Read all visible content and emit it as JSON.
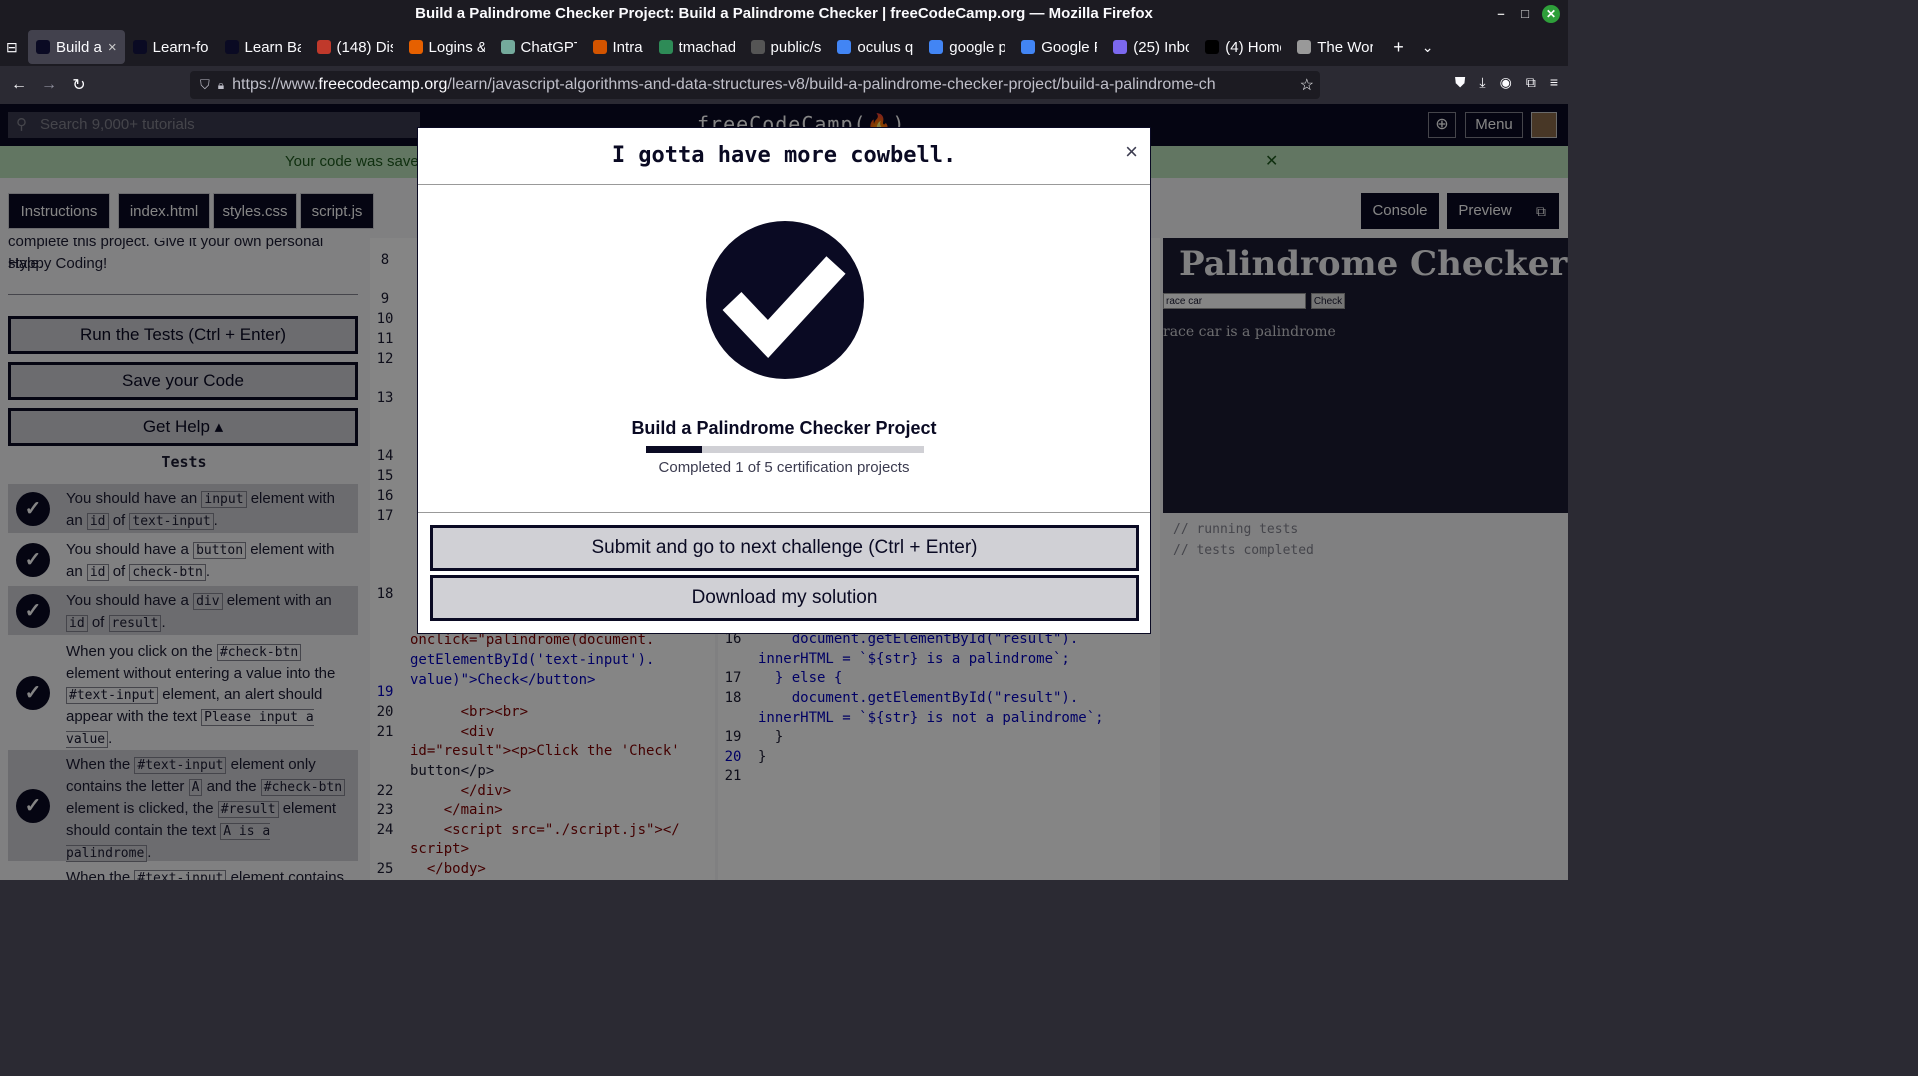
{
  "window": {
    "title": "Build a Palindrome Checker Project: Build a Palindrome Checker | freeCodeCamp.org — Mozilla Firefox"
  },
  "tabs": [
    {
      "label": "Build a",
      "icon": "fcc-icon",
      "color": "#0a0a23",
      "active": true
    },
    {
      "label": "Learn-fo",
      "icon": "fcc-icon",
      "color": "#0a0a23"
    },
    {
      "label": "Learn Ba",
      "icon": "fcc-icon",
      "color": "#0a0a23"
    },
    {
      "label": "(148) Dis",
      "icon": "badge-icon",
      "color": "#c0392b"
    },
    {
      "label": "Logins &",
      "icon": "firefox-icon",
      "color": "#e66000"
    },
    {
      "label": "ChatGPT",
      "icon": "chatgpt-icon",
      "color": "#74aa9c"
    },
    {
      "label": "Intra",
      "icon": "code-icon",
      "color": "#d35400"
    },
    {
      "label": "tmachad",
      "icon": "bug-icon",
      "color": "#2e8b57"
    },
    {
      "label": "public/s",
      "icon": "github-icon",
      "color": "#555555"
    },
    {
      "label": "oculus q",
      "icon": "google-icon",
      "color": "#4285f4"
    },
    {
      "label": "google p",
      "icon": "google-icon",
      "color": "#4285f4"
    },
    {
      "label": "Google F",
      "icon": "google-icon",
      "color": "#4285f4"
    },
    {
      "label": "(25) Inbo",
      "icon": "mail-icon",
      "color": "#7b68ee"
    },
    {
      "label": "(4) Home",
      "icon": "x-icon",
      "color": "#000000"
    },
    {
      "label": "The Wor",
      "icon": "globe-icon",
      "color": "#999999"
    }
  ],
  "url": {
    "prefix": "https://www.",
    "host": "freecodecamp.org",
    "path": "/learn/javascript-algorithms-and-data-structures-v8/build-a-palindrome-checker-project/build-a-palindrome-ch"
  },
  "fcc": {
    "search_placeholder": "Search 9,000+ tutorials",
    "logo": "freeCodeCamp(🔥)",
    "menu": "Menu"
  },
  "banner": {
    "text": "Your code was saved"
  },
  "workspace_tabs": [
    "Instructions",
    "index.html",
    "styles.css",
    "script.js"
  ],
  "right_tabs": [
    "Console",
    "Preview"
  ],
  "instructions": {
    "text1": "complete this project. Give it your own personal style.",
    "text2": "Happy Coding!"
  },
  "buttons": {
    "run": "Run the Tests (Ctrl + Enter)",
    "save": "Save your Code",
    "help": "Get Help ▴"
  },
  "tests_title": "Tests",
  "tests": [
    {
      "a": "You should have an",
      "c1": "input",
      "b": "element with an",
      "c2": "id",
      "d": "of",
      "c3": "text-input",
      "e": "."
    },
    {
      "a": "You should have a",
      "c1": "button",
      "b": "element with an",
      "c2": "id",
      "d": "of",
      "c3": "check-btn",
      "e": "."
    },
    {
      "a": "You should have a",
      "c1": "div",
      "b": "element with an",
      "c2": "id",
      "d": "of",
      "c3": "result",
      "e": "."
    },
    {
      "a": "When you click on the",
      "c1": "#check-btn",
      "b": "element without entering a value into the",
      "c2": "#text-input",
      "d": "element, an alert should appear with the text",
      "c3": "Please input a value",
      "e": "."
    },
    {
      "a": "When the",
      "c1": "#text-input",
      "b": "element only contains the letter",
      "c2": "A",
      "d": "and the",
      "c3": "#check-btn",
      "e": "element is clicked, the",
      "c4": "#result",
      "f": "element should contain the text",
      "c5": "A is a palindrome",
      "g": "."
    },
    {
      "a": "When the",
      "c1": "#text-input",
      "b": "element contains"
    }
  ],
  "editor1": {
    "lines": [
      {
        "n": "8",
        "t": ""
      },
      {
        "n": "9",
        "t": ""
      },
      {
        "n": "10",
        "t": ""
      },
      {
        "n": "11",
        "t": ""
      },
      {
        "n": "12",
        "t": ""
      },
      {
        "n": "13",
        "t": ""
      },
      {
        "n": "14",
        "t": ""
      },
      {
        "n": "15",
        "t": ""
      },
      {
        "n": "16",
        "t": ""
      },
      {
        "n": "17",
        "t": ""
      },
      {
        "n": "18",
        "t": ""
      }
    ],
    "frag1": "onclick=\"palindrome(document.",
    "frag2": "getElementById('text-input').",
    "frag3": "value)\">Check</button>",
    "l19": "19",
    "l20": "20",
    "l20t": "      <br><br>",
    "l21": "21",
    "l21t": "      <div",
    "l21b": "id=\"result\"><p>Click the 'Check'",
    "l21c": "button</p>",
    "l22": "22",
    "l22t": "      </div>",
    "l23": "23",
    "l23t": "    </main>",
    "l24": "24",
    "l24t": "    <script src=\"./script.js\"></",
    "l24b": "script>",
    "l25": "25",
    "l25t": "  </body>"
  },
  "editor2": {
    "l16": "16",
    "l16t": "    document.getElementById(\"result\").",
    "l16b": "innerHTML = `${str} is a palindrome`;",
    "l17": "17",
    "l17t": "  } else {",
    "l18": "18",
    "l18t": "    document.getElementById(\"result\").",
    "l18b": "innerHTML = `${str} is not a palindrome`;",
    "l19": "19",
    "l19t": "  }",
    "l20": "20",
    "l20t": "}",
    "l21": "21"
  },
  "preview": {
    "title": "Palindrome Checker",
    "input_value": "race car",
    "check": "Check",
    "result": "race car is a palindrome"
  },
  "console": {
    "line1": "// running tests",
    "line2": "// tests completed"
  },
  "modal": {
    "title": "I gotta have more cowbell.",
    "close": "×",
    "project": "Build a Palindrome Checker Project",
    "progress": {
      "completed": 1,
      "total": 5
    },
    "progress_text": "Completed 1 of 5 certification projects",
    "submit": "Submit and go to next challenge (Ctrl + Enter)",
    "download": "Download my solution"
  }
}
